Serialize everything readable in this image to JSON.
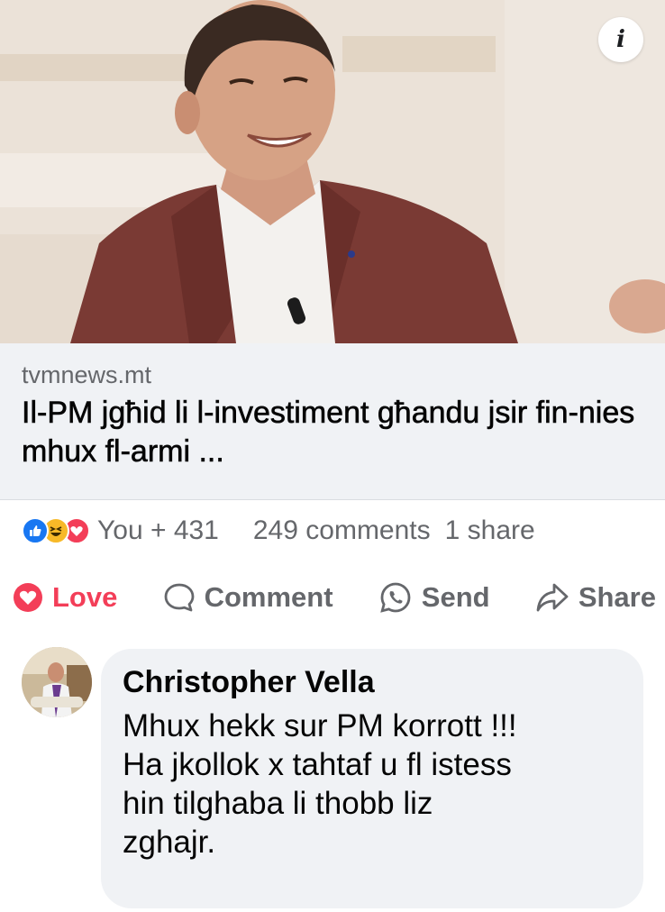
{
  "link_preview": {
    "domain": "tvmnews.mt",
    "title": "Il-PM jgħid li l-investiment għandu jsir fin-nies mhux fl-armi ...",
    "info_icon": "info-icon"
  },
  "reactions": {
    "icons": [
      "like-icon",
      "haha-icon",
      "love-icon"
    ],
    "reacted_text": "You + 431",
    "comments_text": "249 comments",
    "shares_text": "1 share"
  },
  "actions": {
    "love_label": "Love",
    "comment_label": "Comment",
    "send_label": "Send",
    "share_label": "Share"
  },
  "comment": {
    "author": "Christopher Vella",
    "text": "Mhux hekk sur PM korrott !!!\nHa jkollok x tahtaf u fl istess\nhin tilghaba li thobb liz\nzghajr."
  },
  "colors": {
    "love": "#f33e58",
    "like": "#1877f2",
    "haha": "#f7b928",
    "secondary_text": "#65676b",
    "bubble_bg": "#f0f2f5"
  }
}
